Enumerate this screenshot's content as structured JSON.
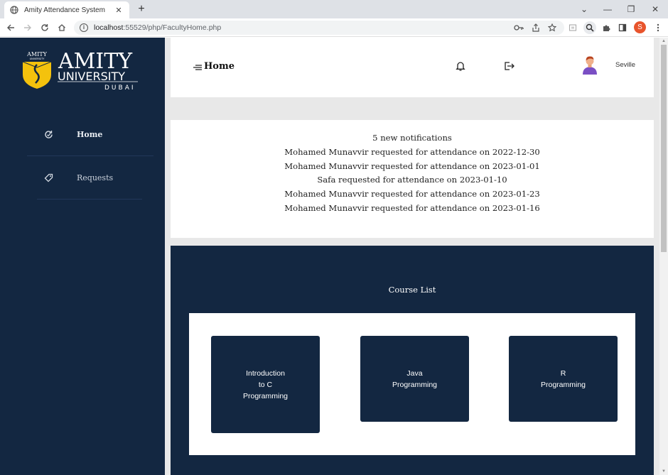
{
  "browser": {
    "tab_title": "Amity Attendance System",
    "tab_close": "✕",
    "new_tab": "+",
    "url_host": "localhost",
    "url_path": ":55529/php/FacultyHome.php",
    "profile_initial": "S",
    "window_controls": [
      "⌄",
      "—",
      "❐",
      "✕"
    ]
  },
  "logo": {
    "small": "AMITY",
    "small_sub": "UNIVERSITY",
    "main": "AMITY",
    "sub": "UNIVERSITY",
    "city": "DUBAI"
  },
  "sidebar": {
    "items": [
      {
        "label": "Home",
        "icon": "refresh-icon"
      },
      {
        "label": "Requests",
        "icon": "tag-icon"
      }
    ]
  },
  "header": {
    "title": "Home",
    "username": "Seville"
  },
  "notifications": {
    "count_text": "5 new notifications",
    "items": [
      "Mohamed Munavvir requested for attendance on 2022-12-30",
      "Mohamed Munavvir requested for attendance on 2023-01-01",
      "Safa requested for attendance on 2023-01-10",
      "Mohamed Munavvir requested for attendance on 2023-01-23",
      "Mohamed Munavvir requested for attendance on 2023-01-16"
    ]
  },
  "courses": {
    "heading": "Course List",
    "items": [
      {
        "name": "Introduction\nto C\nProgramming"
      },
      {
        "name": "Java\nProgramming"
      },
      {
        "name": "R\nProgramming"
      }
    ]
  },
  "colors": {
    "navy": "#132741",
    "page_bg": "#e8e8e8",
    "logo_yellow": "#f4c20d"
  }
}
